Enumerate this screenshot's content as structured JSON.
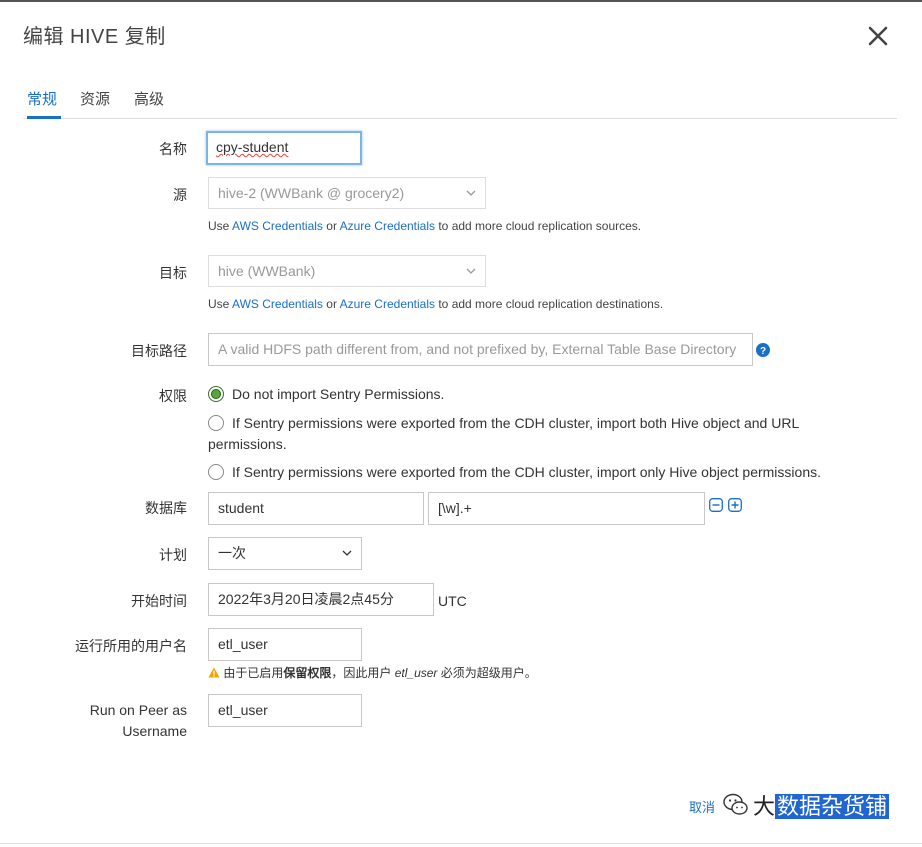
{
  "dialog": {
    "title": "编辑 HIVE 复制"
  },
  "tabs": [
    {
      "label": "常规"
    },
    {
      "label": "资源"
    },
    {
      "label": "高级"
    }
  ],
  "form": {
    "name": {
      "label": "名称",
      "value": "cpy-student"
    },
    "source": {
      "label": "源",
      "selected": "hive-2 (WWBank @ grocery2)",
      "help_prefix": "Use ",
      "help_link1": "AWS Credentials",
      "help_mid": " or ",
      "help_link2": "Azure Credentials",
      "help_suffix": " to add more cloud replication sources."
    },
    "target": {
      "label": "目标",
      "selected": "hive (WWBank)",
      "help_prefix": "Use ",
      "help_link1": "AWS Credentials",
      "help_mid": " or ",
      "help_link2": "Azure Credentials",
      "help_suffix": " to add more cloud replication destinations."
    },
    "target_path": {
      "label": "目标路径",
      "placeholder": "A valid HDFS path different from, and not prefixed by, External Table Base Directory"
    },
    "permissions": {
      "label": "权限",
      "options": [
        {
          "text": "Do not import Sentry Permissions.",
          "checked": true
        },
        {
          "text_line1": "If Sentry permissions were exported from the CDH cluster, import both Hive object and URL",
          "text_line2": "permissions.",
          "checked": false
        },
        {
          "text": "If Sentry permissions were exported from the CDH cluster, import only Hive object permissions.",
          "checked": false
        }
      ]
    },
    "database": {
      "label": "数据库",
      "db_value": "student",
      "table_value": "[\\w].+"
    },
    "schedule": {
      "label": "计划",
      "selected": "一次"
    },
    "start_time": {
      "label": "开始时间",
      "value": "2022年3月20日凌晨2点45分",
      "timezone": "UTC"
    },
    "run_as": {
      "label": "运行所用的用户名",
      "value": "etl_user",
      "warning_part1": "由于已启用",
      "warning_bold": "保留权限",
      "warning_part2": "，因此用户 ",
      "warning_user": "etl_user",
      "warning_part3": " 必须为超级用户。"
    },
    "run_on_peer": {
      "label_line1": "Run on Peer as",
      "label_line2": "Username",
      "value": "etl_user"
    }
  },
  "footer": {
    "cancel_label": "取消",
    "watermark_prefix": "大",
    "watermark_highlight": "数据杂货铺"
  },
  "colors": {
    "accent": "#1a6fc7",
    "radio_checked": "#5aa53c",
    "warning": "#f0a500"
  },
  "icons": [
    "close-icon",
    "chevron-down-icon",
    "help-icon",
    "minus-icon",
    "plus-icon",
    "warning-icon",
    "wechat-icon"
  ]
}
